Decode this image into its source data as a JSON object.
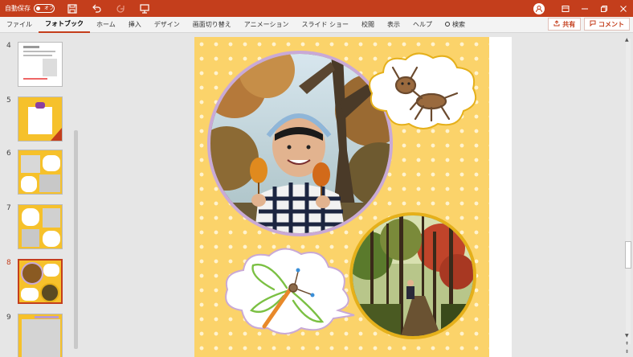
{
  "titlebar": {
    "autosave_label": "自動保存",
    "autosave_state": "オフ",
    "icons": [
      "save-icon",
      "undo-icon",
      "redo-icon",
      "present-icon"
    ],
    "window_controls": [
      "ribbon-display-icon",
      "minimize-icon",
      "restore-icon",
      "close-icon"
    ]
  },
  "ribbon": {
    "tabs": [
      {
        "label": "ファイル"
      },
      {
        "label": "フォトブック",
        "active": true
      },
      {
        "label": "ホーム"
      },
      {
        "label": "挿入"
      },
      {
        "label": "デザイン"
      },
      {
        "label": "画面切り替え"
      },
      {
        "label": "アニメーション"
      },
      {
        "label": "スライド ショー"
      },
      {
        "label": "校閲"
      },
      {
        "label": "表示"
      },
      {
        "label": "ヘルプ"
      }
    ],
    "search_label": "検索",
    "share_label": "共有",
    "comment_label": "コメント"
  },
  "thumbnails": [
    {
      "num": "4",
      "active": false
    },
    {
      "num": "5",
      "active": false
    },
    {
      "num": "6",
      "active": false
    },
    {
      "num": "7",
      "active": false
    },
    {
      "num": "8",
      "active": true
    },
    {
      "num": "9",
      "active": false
    }
  ],
  "colors": {
    "accent": "#c43e1c",
    "slide_bg": "#fbd36a",
    "photo1_frame": "#c9a9d6",
    "photo2_frame": "#e5b01a",
    "drawing_brown": "#6b4a2e",
    "drawing_green": "#7bc043",
    "drawing_orange": "#e8892a"
  }
}
